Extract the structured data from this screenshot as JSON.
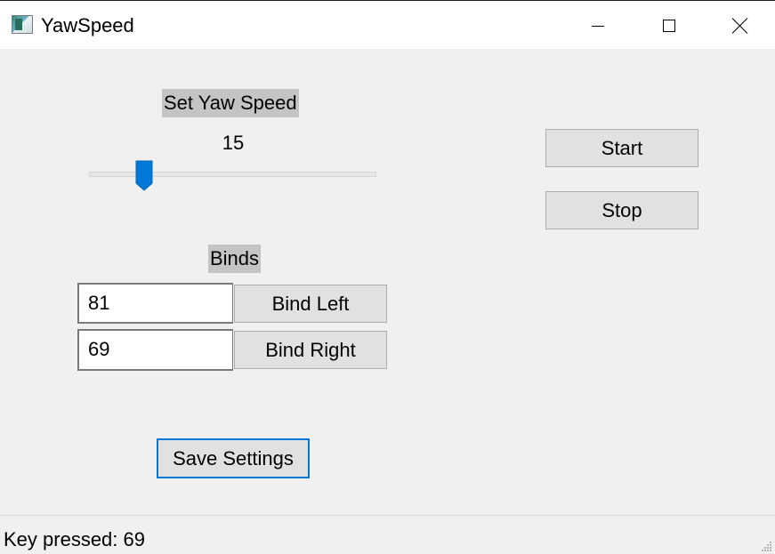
{
  "window": {
    "title": "YawSpeed",
    "icon": "app-window-icon",
    "controls": [
      "minimize-icon",
      "maximize-icon",
      "close-icon"
    ]
  },
  "yaw": {
    "label": "Set Yaw Speed",
    "value": "15",
    "slider_fraction": 0.16,
    "accent_color": "#0078d7"
  },
  "binds": {
    "label": "Binds",
    "left_value": "81",
    "left_button": "Bind Left",
    "right_value": "69",
    "right_button": "Bind Right"
  },
  "controls": {
    "start": "Start",
    "stop": "Stop"
  },
  "save": {
    "label": "Save Settings"
  },
  "status": {
    "text": "Key pressed: 69"
  }
}
